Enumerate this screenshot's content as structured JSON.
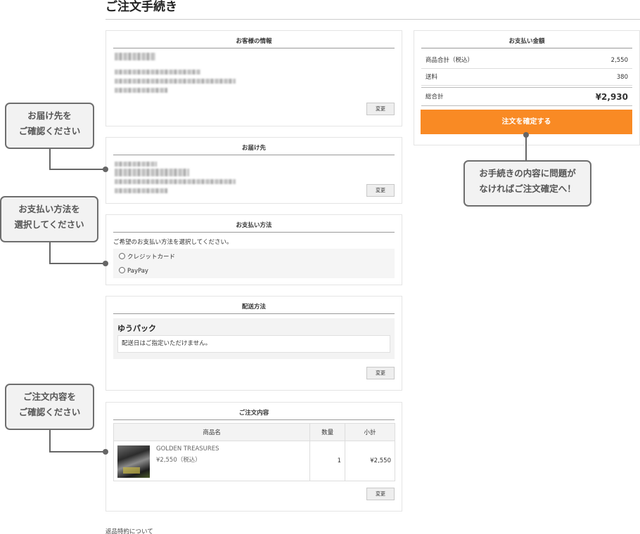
{
  "page": {
    "title": "ご注文手続き"
  },
  "customer": {
    "heading": "お客様の情報",
    "change_label": "変更"
  },
  "delivery": {
    "heading": "お届け先",
    "change_label": "変更"
  },
  "payment": {
    "heading": "お支払い方法",
    "instruction": "ご希望のお支払い方法を選択してください。",
    "options": [
      "クレジットカード",
      "PayPay"
    ]
  },
  "shipping": {
    "heading": "配送方法",
    "method": "ゆうパック",
    "note": "配送日はご指定いただけません。",
    "change_label": "変更"
  },
  "order": {
    "heading": "ご注文内容",
    "columns": [
      "商品名",
      "数量",
      "小計"
    ],
    "item": {
      "name": "GOLDEN TREASURES",
      "price": "¥2,550（税込）",
      "qty": "1",
      "subtotal": "¥2,550"
    },
    "change_label": "変更"
  },
  "summary": {
    "heading": "お支払い金額",
    "rows": [
      {
        "label": "商品合計（税込）",
        "value": "2,550"
      },
      {
        "label": "送料",
        "value": "380"
      },
      {
        "label": "総合計",
        "value": "¥2,930"
      }
    ],
    "confirm_label": "注文を確定する"
  },
  "callouts": {
    "delivery": [
      "お届け先を",
      "ご確認ください"
    ],
    "payment": [
      "お支払い方法を",
      "選択してください"
    ],
    "order": [
      "ご注文内容を",
      "ご確認ください"
    ],
    "confirm": [
      "お手続きの内容に問題が",
      "なければご注文確定へ！"
    ]
  },
  "footer": {
    "returns_link": "返品特約について"
  },
  "colors": {
    "accent": "#f98a24",
    "callout_border": "#6e6e6e"
  },
  "icons": {
    "radio": "radio-circle"
  }
}
